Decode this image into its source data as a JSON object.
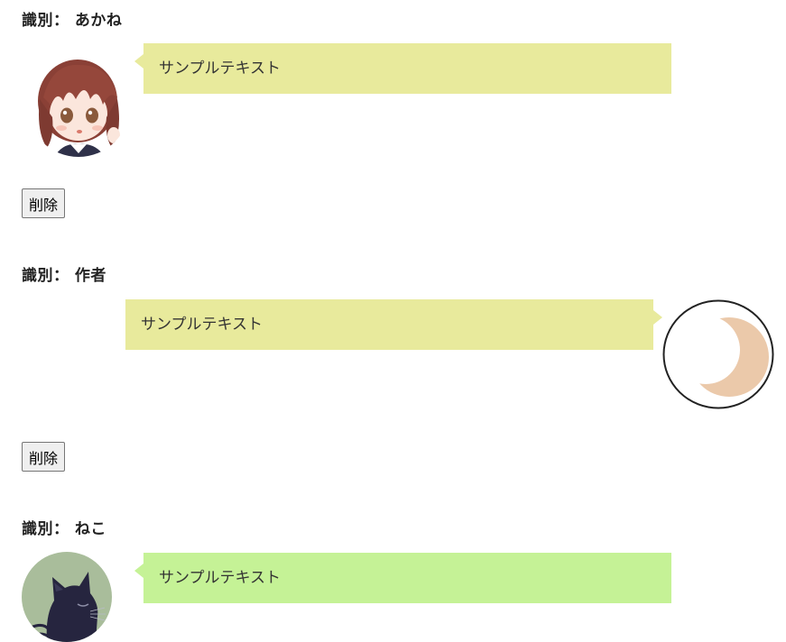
{
  "messages": [
    {
      "label": "識別： あかね",
      "text": "サンプルテキスト",
      "avatar_icon": "anime-girl-avatar-icon",
      "bubble_color": "#e8ea9c",
      "delete_label": "削除"
    },
    {
      "label": "識別： 作者",
      "text": "サンプルテキスト",
      "avatar_icon": "crescent-moon-avatar-icon",
      "bubble_color": "#e8ea9c",
      "delete_label": "削除"
    },
    {
      "label": "識別： ねこ",
      "text": "サンプルテキスト",
      "avatar_icon": "black-cat-avatar-icon",
      "bubble_color": "#c5f296"
    }
  ]
}
